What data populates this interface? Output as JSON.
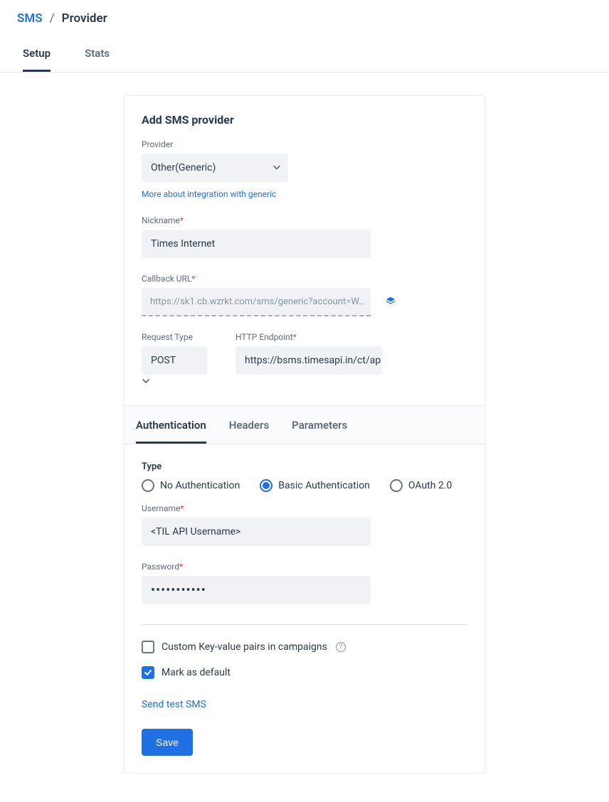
{
  "breadcrumb": {
    "root": "SMS",
    "sep": "/",
    "current": "Provider"
  },
  "tabs": {
    "setup": "Setup",
    "stats": "Stats"
  },
  "card": {
    "title": "Add SMS provider",
    "provider_label": "Provider",
    "provider_value": "Other(Generic)",
    "integration_link": "More about integration with generic",
    "nickname_label": "Nickname",
    "nickname_value": "Times Internet",
    "callback_label": "Callback URL",
    "callback_value": "https://sk1.cb.wzrkt.com/sms/generic?account=W…",
    "request_type_label": "Request Type",
    "request_type_value": "POST",
    "endpoint_label": "HTTP Endpoint",
    "endpoint_value": "https://bsms.timesapi.in/ct/api…"
  },
  "subtabs": {
    "auth": "Authentication",
    "headers": "Headers",
    "params": "Parameters"
  },
  "auth": {
    "type_label": "Type",
    "opt_none": "No Authentication",
    "opt_basic": "Basic Authentication",
    "opt_oauth": "OAuth 2.0",
    "username_label": "Username",
    "username_value": "<TIL API Username>",
    "password_label": "Password",
    "password_value": "•••••••••••"
  },
  "options": {
    "custom_kv": "Custom Key-value pairs in campaigns",
    "mark_default": "Mark as default",
    "send_test": "Send test SMS",
    "save": "Save"
  }
}
